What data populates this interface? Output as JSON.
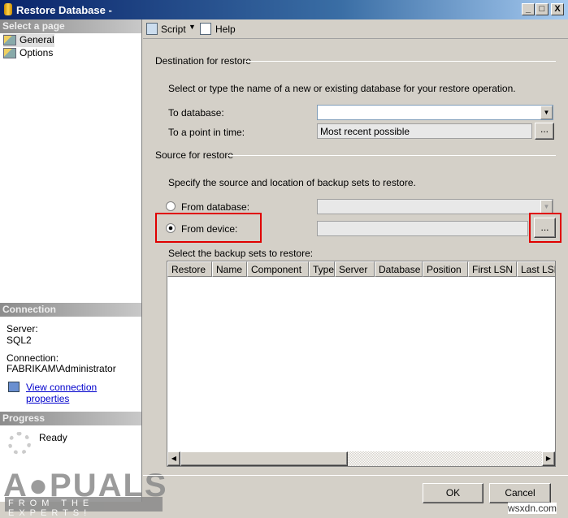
{
  "window": {
    "title": "Restore Database -",
    "minimize": "_",
    "maximize": "□",
    "close": "X"
  },
  "left": {
    "select_page_header": "Select a page",
    "pages": [
      {
        "label": "General",
        "selected": true
      },
      {
        "label": "Options",
        "selected": false
      }
    ],
    "connection_header": "Connection",
    "server_label": "Server:",
    "server_value": "SQL2",
    "connection_label": "Connection:",
    "connection_value": "FABRIKAM\\Administrator",
    "view_properties_link": "View connection properties",
    "progress_header": "Progress",
    "progress_status": "Ready"
  },
  "toolbar": {
    "script_label": "Script",
    "help_label": "Help"
  },
  "destination": {
    "section_title": "Destination for restore",
    "instructions": "Select or type the name of a new or existing database for your restore operation.",
    "to_database_label": "To database:",
    "to_database_value": "",
    "point_in_time_label": "To a point in time:",
    "point_in_time_value": "Most recent possible",
    "browse_label": "..."
  },
  "source": {
    "section_title": "Source for restore",
    "instructions": "Specify the source and location of backup sets to restore.",
    "from_database_label": "From database:",
    "from_device_label": "From device:",
    "selected": "From device",
    "browse_label": "...",
    "backup_sets_label": "Select the backup sets to restore:",
    "columns": [
      "Restore",
      "Name",
      "Component",
      "Type",
      "Server",
      "Database",
      "Position",
      "First LSN",
      "Last LSN"
    ]
  },
  "buttons": {
    "ok": "OK",
    "cancel": "Cancel"
  },
  "watermark": {
    "logo": "APPUALS",
    "tagline": "FROM THE EXPERTS!",
    "site": "wsxdn.com"
  },
  "colors": {
    "highlight": "#e00000",
    "title_bar": "#0a246a"
  }
}
